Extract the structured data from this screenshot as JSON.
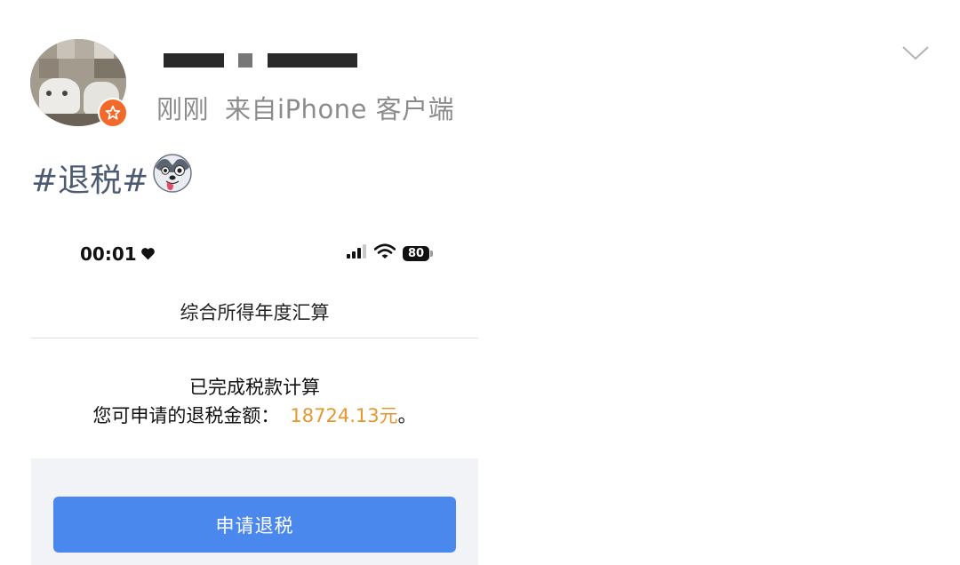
{
  "post": {
    "meta_time": "刚刚",
    "meta_source": "来自iPhone 客户端",
    "text": "#退税#",
    "icons": {
      "avatar": "cat-avatar",
      "badge": "star-badge-icon",
      "more": "chevron-down-icon",
      "emoji": "husky-tongue-emoji"
    }
  },
  "screenshot": {
    "status_bar": {
      "time": "00:01",
      "battery": "80",
      "icons": [
        "heart-icon",
        "signal-icon",
        "wifi-icon",
        "battery-icon"
      ]
    },
    "nav_title": "综合所得年度汇算",
    "done_text": "已完成税款计算",
    "refund_label": "您可申请的退税金额：",
    "refund_amount": "18724.13元",
    "refund_suffix": "。",
    "apply_button": "申请退税",
    "colors": {
      "amount": "#e6962e",
      "button": "#4a88ee"
    }
  }
}
